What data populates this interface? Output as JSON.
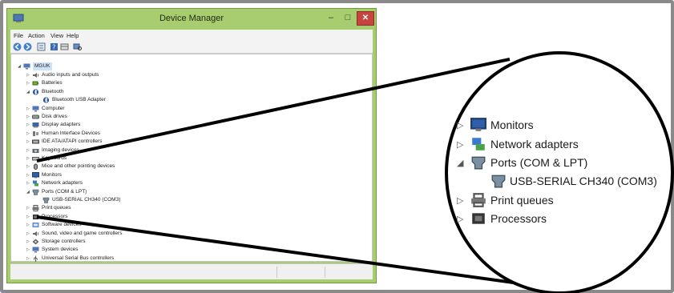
{
  "window": {
    "title": "Device Manager",
    "controls": {
      "minimize": "–",
      "maximize": "□",
      "close": "✕"
    }
  },
  "menu": [
    "File",
    "Action",
    "View",
    "Help"
  ],
  "toolbar": [
    "back-icon",
    "forward-icon",
    "properties-icon",
    "help-icon",
    "view-icon",
    "scan-icon"
  ],
  "tree": {
    "root": "MGUK",
    "items": [
      {
        "label": "Audio inputs and outputs",
        "expanded": false,
        "icon": "speaker-icon"
      },
      {
        "label": "Batteries",
        "expanded": false,
        "icon": "battery-icon"
      },
      {
        "label": "Bluetooth",
        "expanded": true,
        "icon": "bluetooth-icon"
      },
      {
        "label": "Bluetooth USB Adapter",
        "child": true,
        "icon": "bluetooth-icon"
      },
      {
        "label": "Computer",
        "expanded": false,
        "icon": "computer-icon"
      },
      {
        "label": "Disk drives",
        "expanded": false,
        "icon": "disk-icon"
      },
      {
        "label": "Display adapters",
        "expanded": false,
        "icon": "display-icon"
      },
      {
        "label": "Human Interface Devices",
        "expanded": false,
        "icon": "hid-icon"
      },
      {
        "label": "IDE ATA/ATAPI controllers",
        "expanded": false,
        "icon": "ide-icon"
      },
      {
        "label": "Imaging devices",
        "expanded": false,
        "icon": "camera-icon"
      },
      {
        "label": "Keyboards",
        "expanded": false,
        "icon": "keyboard-icon"
      },
      {
        "label": "Mice and other pointing devices",
        "expanded": false,
        "icon": "mouse-icon"
      },
      {
        "label": "Monitors",
        "expanded": false,
        "icon": "monitor-icon"
      },
      {
        "label": "Network adapters",
        "expanded": false,
        "icon": "network-icon"
      },
      {
        "label": "Ports (COM & LPT)",
        "expanded": true,
        "icon": "port-icon"
      },
      {
        "label": "USB-SERIAL CH340 (COM3)",
        "child": true,
        "icon": "port-icon"
      },
      {
        "label": "Print queues",
        "expanded": false,
        "icon": "printer-icon"
      },
      {
        "label": "Processors",
        "expanded": false,
        "icon": "processor-icon"
      },
      {
        "label": "Software devices",
        "expanded": false,
        "icon": "software-icon"
      },
      {
        "label": "Sound, video and game controllers",
        "expanded": false,
        "icon": "speaker-icon"
      },
      {
        "label": "Storage controllers",
        "expanded": false,
        "icon": "storage-icon"
      },
      {
        "label": "System devices",
        "expanded": false,
        "icon": "computer-icon"
      },
      {
        "label": "Universal Serial Bus controllers",
        "expanded": false,
        "icon": "usb-icon"
      }
    ]
  },
  "zoom": {
    "items": [
      {
        "label": "Monitors",
        "expanded": false,
        "icon": "monitor-icon"
      },
      {
        "label": "Network adapters",
        "expanded": false,
        "icon": "network-icon"
      },
      {
        "label": "Ports (COM & LPT)",
        "expanded": true,
        "icon": "port-icon"
      },
      {
        "label": "USB-SERIAL CH340 (COM3)",
        "child": true,
        "icon": "port-icon"
      },
      {
        "label": "Print queues",
        "expanded": false,
        "icon": "printer-icon"
      },
      {
        "label": "Processors",
        "expanded": false,
        "icon": "processor-icon"
      }
    ]
  },
  "colors": {
    "window_frame": "#a8cd6e",
    "close_button": "#c7453e",
    "callout_stroke": "#000000",
    "selection": "#cfe3f7"
  }
}
